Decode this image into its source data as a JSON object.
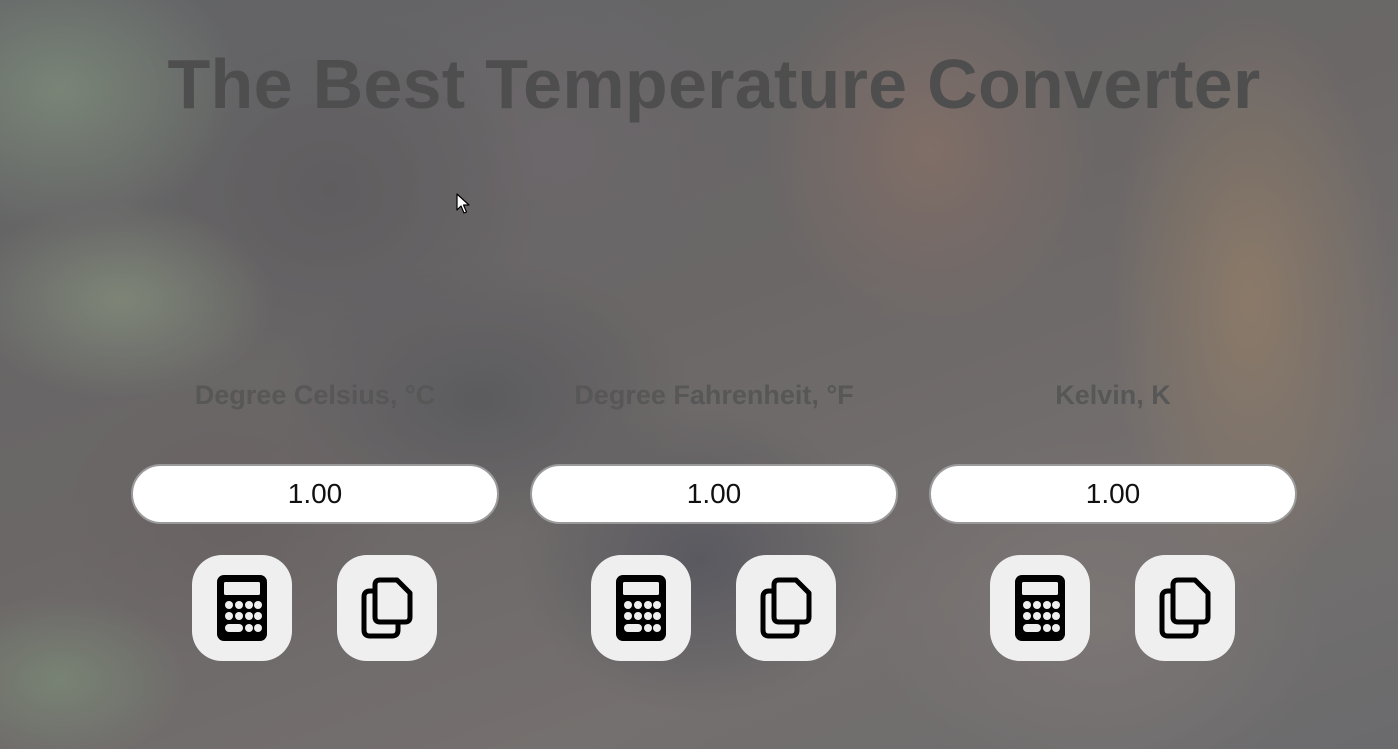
{
  "page": {
    "title": "The Best Temperature Converter"
  },
  "units": [
    {
      "label": "Degree Celsius, °C",
      "value": "1.00",
      "calculate_icon": "calculator-icon",
      "copy_icon": "copy-icon"
    },
    {
      "label": "Degree Fahrenheit, °F",
      "value": "1.00",
      "calculate_icon": "calculator-icon",
      "copy_icon": "copy-icon"
    },
    {
      "label": "Kelvin, K",
      "value": "1.00",
      "calculate_icon": "calculator-icon",
      "copy_icon": "copy-icon"
    }
  ],
  "colors": {
    "title": "#4e4e4e",
    "label": "#575757",
    "button_bg": "#efefef",
    "input_bg": "#ffffff"
  }
}
